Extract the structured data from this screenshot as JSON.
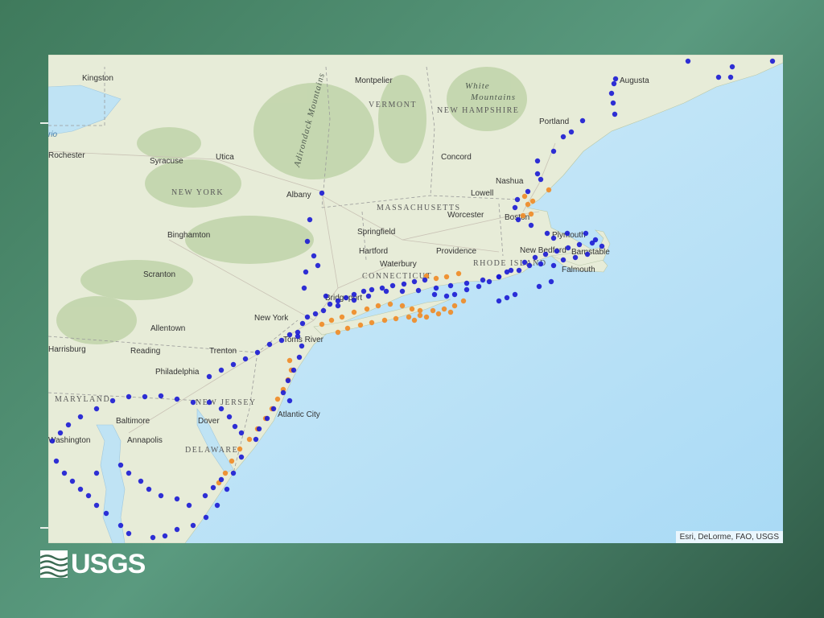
{
  "map": {
    "attribution": "Esri, DeLorme, FAO, USGS",
    "labels": {
      "kingston": "Kingston",
      "montpelier": "Montpelier",
      "augusta": "Augusta",
      "white_mountains_1": "White",
      "white_mountains_2": "Mountains",
      "vermont": "VERMONT",
      "new_hampshire": "NEW HAMPSHIRE",
      "portland": "Portland",
      "adirondack": "Adirondack Mountains",
      "ontario_fragment": "rio",
      "rochester": "Rochester",
      "syracuse": "Syracuse",
      "utica": "Utica",
      "concord": "Concord",
      "new_york_state": "NEW YORK",
      "albany": "Albany",
      "nashua": "Nashua",
      "lowell": "Lowell",
      "boston": "Boston",
      "massachusetts": "MASSACHUSETTS",
      "worcester": "Worcester",
      "springfield": "Springfield",
      "binghamton": "Binghamton",
      "plymouth": "Plymouth",
      "hartford": "Hartford",
      "providence": "Providence",
      "new_bedford": "New Bedford",
      "barnstable": "Barnstable",
      "waterbury": "Waterbury",
      "rhode_island": "RHODE ISLAND",
      "connecticut": "CONNECTICUT",
      "scranton": "Scranton",
      "falmouth": "Falmouth",
      "bridgeport": "Bridgeport",
      "new_york_city": "New York",
      "allentown": "Allentown",
      "harrisburg": "Harrisburg",
      "reading": "Reading",
      "trenton": "Trenton",
      "toms_river": "Toms River",
      "philadelphia": "Philadelphia",
      "maryland": "MARYLAND",
      "new_jersey": "NEW JERSEY",
      "baltimore": "Baltimore",
      "dover": "Dover",
      "atlantic_city": "Atlantic City",
      "washington": "Washington",
      "annapolis": "Annapolis",
      "delaware": "DELAWARE"
    },
    "legend_colors": {
      "blue_sites": "#1a1ad4",
      "orange_sites": "#f08a24"
    }
  },
  "logo": {
    "text": "USGS"
  }
}
